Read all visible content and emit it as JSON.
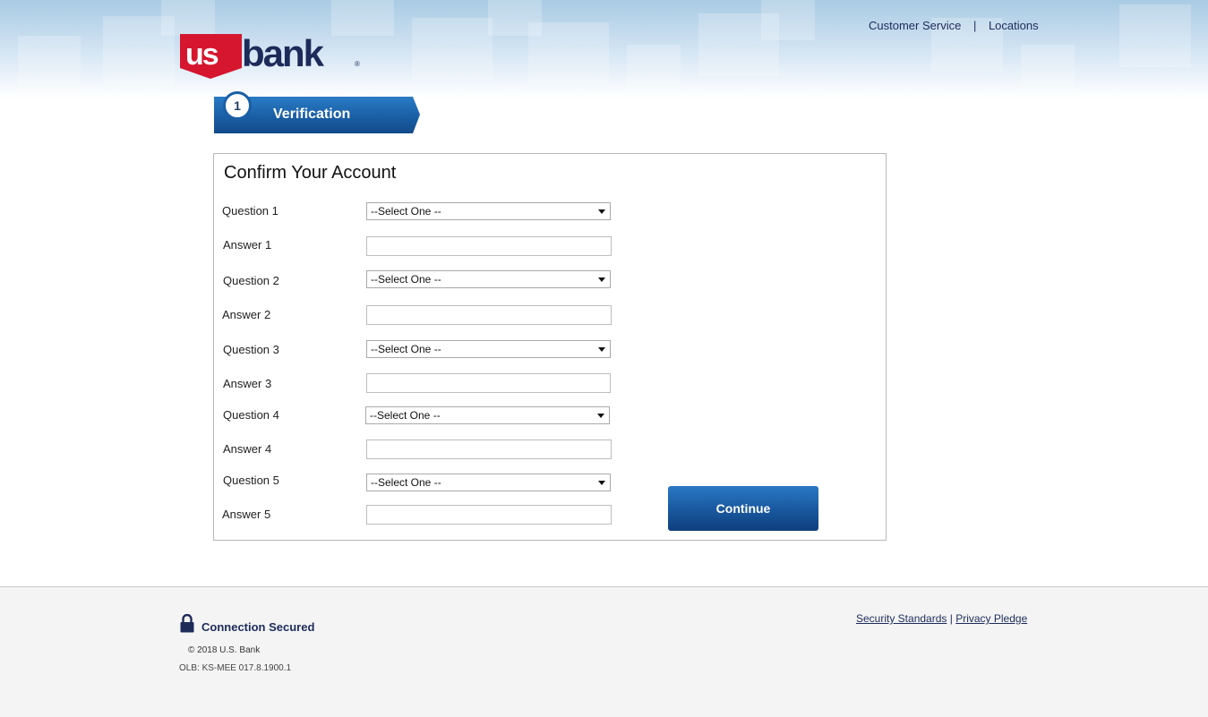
{
  "header": {
    "brand": "usbank",
    "customer_service": "Customer Service",
    "separator": "|",
    "locations": "Locations",
    "brand_colors": {
      "red": "#d6162e",
      "navy": "#1d2b5a"
    }
  },
  "step": {
    "number": "1",
    "label": "Verification"
  },
  "form": {
    "title": "Confirm Your Account",
    "rows": [
      {
        "question_label": "Question 1",
        "select_value": "--Select One --",
        "answer_label": "Answer 1",
        "answer_value": ""
      },
      {
        "question_label": "Question 2",
        "select_value": "--Select One --",
        "answer_label": "Answer 2",
        "answer_value": ""
      },
      {
        "question_label": "Question 3",
        "select_value": "--Select One --",
        "answer_label": "Answer 3",
        "answer_value": ""
      },
      {
        "question_label": "Question 4",
        "select_value": "--Select One --",
        "answer_label": "Answer 4",
        "answer_value": ""
      },
      {
        "question_label": "Question 5",
        "select_value": "--Select One --",
        "answer_label": "Answer 5",
        "answer_value": ""
      }
    ],
    "continue_label": "Continue"
  },
  "footer": {
    "secured": "Connection Secured",
    "copyright": "©  2018 U.S. Bank",
    "olb": "OLB: KS-MEE 017.8.1900.1",
    "security_standards": "Security Standards",
    "separator": "|",
    "privacy_pledge": "Privacy Pledge"
  },
  "colors": {
    "accent_blue": "#1a5aa1",
    "panel_border": "#b8b8b8"
  }
}
